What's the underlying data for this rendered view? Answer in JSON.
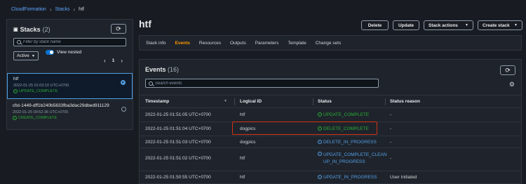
{
  "breadcrumb": [
    "CloudFormation",
    "Stacks",
    "htf"
  ],
  "left_panel": {
    "title": "Stacks",
    "count": "(2)",
    "search_placeholder": "Filter by stack name",
    "status_filter": "Active",
    "view_nested_label": "View nested",
    "page": "1",
    "stacks": [
      {
        "name": "htf",
        "date": "2022-01-25 01:03:10 UTC+0700",
        "status": "UPDATE_COMPLETE",
        "selected": true
      },
      {
        "name": "cfst-1449-dff1b240b5633fba3dac29dbed911129",
        "date": "2022-01-25 00:52:36 UTC+0700",
        "status": "CREATE_COMPLETE",
        "selected": false
      }
    ]
  },
  "main": {
    "title": "htf",
    "buttons": {
      "delete": "Delete",
      "update": "Update",
      "stack_actions": "Stack actions",
      "create_stack": "Create stack"
    },
    "tabs": [
      "Stack info",
      "Events",
      "Resources",
      "Outputs",
      "Parameters",
      "Template",
      "Change sets"
    ],
    "active_tab": "Events"
  },
  "events": {
    "title": "Events",
    "count": "(16)",
    "search_placeholder": "Search events",
    "columns": [
      "Timestamp",
      "Logical ID",
      "Status",
      "Status reason"
    ],
    "rows": [
      {
        "timestamp": "2022-01-25 01:51:05 UTC+0700",
        "logical_id": "htf",
        "status_lines": [
          "UPDATE_COMPLETE"
        ],
        "status_color": "green",
        "reason": "-"
      },
      {
        "timestamp": "2022-01-25 01:51:04 UTC+0700",
        "logical_id": "dogpics",
        "status_lines": [
          "DELETE_COMPLETE"
        ],
        "status_color": "green",
        "reason": "-"
      },
      {
        "timestamp": "2022-01-25 01:51:03 UTC+0700",
        "logical_id": "dogpics",
        "status_lines": [
          "DELETE_IN_PROGRESS"
        ],
        "status_color": "blue",
        "reason": "-"
      },
      {
        "timestamp": "2022-01-25 01:51:02 UTC+0700",
        "logical_id": "htf",
        "status_lines": [
          "UPDATE_COMPLETE_CLEAN",
          "UP_IN_PROGRESS"
        ],
        "status_color": "blue",
        "reason": "-"
      },
      {
        "timestamp": "2022-01-25 01:50:55 UTC+0700",
        "logical_id": "htf",
        "status_lines": [
          "UPDATE_IN_PROGRESS"
        ],
        "status_color": "blue",
        "reason": "User Initiated"
      }
    ]
  },
  "colors": {
    "background": "#181c22",
    "panel": "#1f242c",
    "link": "#5ea4ff",
    "active_tab": "#ff9900",
    "success": "#29ad32",
    "info": "#539fe5",
    "highlight": "#d13212"
  },
  "icons": [
    "chevron-right-icon",
    "collapse-icon",
    "refresh-icon",
    "search-icon",
    "caret-down-icon",
    "chevron-left-icon",
    "check-circle-icon",
    "info-circle-icon",
    "gear-icon",
    "sort-icon"
  ]
}
